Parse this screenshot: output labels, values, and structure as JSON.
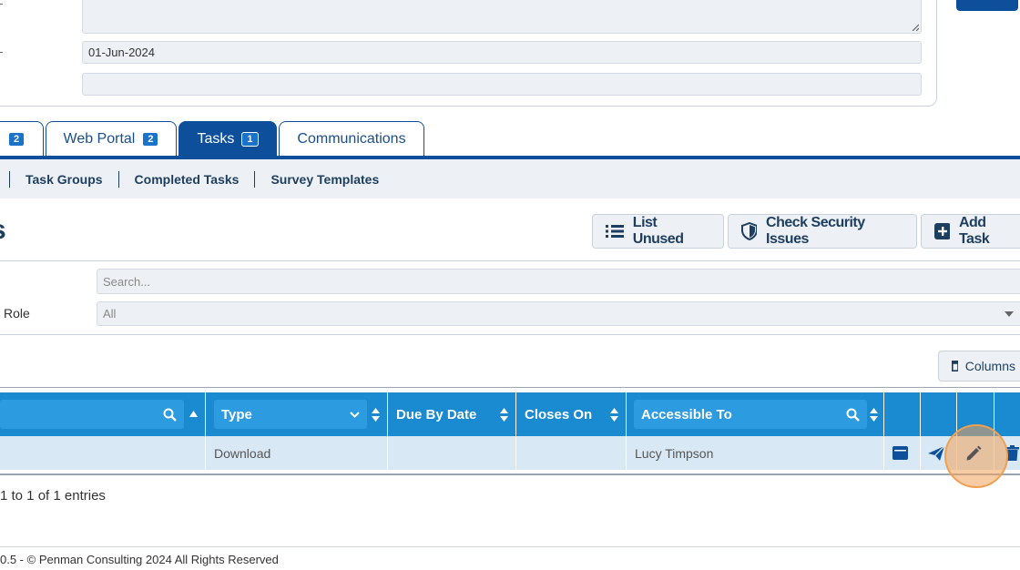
{
  "form": {
    "date_value": "01-Jun-2024",
    "blank_value": ""
  },
  "tabs": [
    {
      "label": "",
      "badge": "2"
    },
    {
      "label": "Web Portal",
      "badge": "2"
    },
    {
      "label": "Tasks",
      "badge": "1"
    },
    {
      "label": "Communications",
      "badge": ""
    }
  ],
  "subnav": [
    "Task Groups",
    "Completed Tasks",
    "Survey Templates"
  ],
  "page": {
    "heading": "s",
    "buttons": {
      "list_unused": "List Unused",
      "check_security": "Check Security Issues",
      "add_task": "Add Task"
    }
  },
  "filters": {
    "search_placeholder": "Search...",
    "role_label": "Role",
    "role_value": "All"
  },
  "columns_button": "Columns",
  "table": {
    "headers": [
      "",
      "Type",
      "Due By Date",
      "Closes On",
      "Accessible To"
    ],
    "row": {
      "name": "",
      "type": "Download",
      "due": "",
      "closes": "",
      "accessible": "Lucy Timpson"
    }
  },
  "info": "1 to 1 of 1 entries",
  "footer": "0.5 - © Penman Consulting 2024 All Rights Reserved",
  "colors": {
    "primary": "#0d4f9a",
    "header": "#1a8ad1",
    "highlight": "#f0a050"
  }
}
